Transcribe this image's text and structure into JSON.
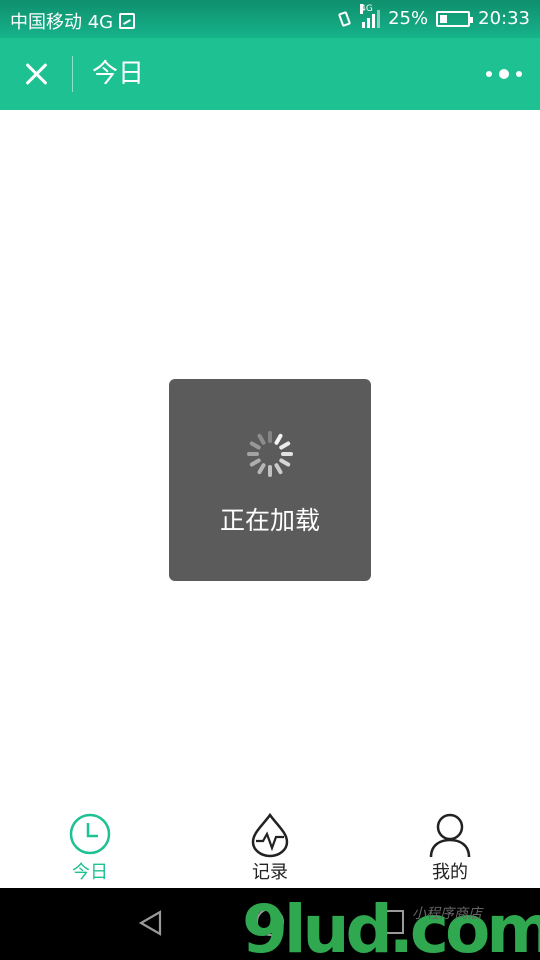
{
  "status_bar": {
    "carrier": "中国移动 4G",
    "signal_badge": "4G",
    "battery_percent": "25%",
    "battery_level": 0.25,
    "time": "20:33"
  },
  "nav": {
    "title": "今日",
    "icons": {
      "close": "close-icon",
      "more": "more-icon"
    }
  },
  "toast": {
    "text": "正在加载"
  },
  "tabbar": {
    "active_color": "#1ec192",
    "inactive_color": "#222222",
    "tabs": [
      {
        "label": "今日",
        "icon": "clock-icon",
        "active": true
      },
      {
        "label": "记录",
        "icon": "heartbeat-drop-icon",
        "active": false
      },
      {
        "label": "我的",
        "icon": "user-icon",
        "active": false
      }
    ]
  },
  "watermark": {
    "text": "9lud.com",
    "subtext": "小程序商店"
  },
  "colors": {
    "brand": "#1ec192",
    "toast_bg": "#5b5b5b"
  }
}
